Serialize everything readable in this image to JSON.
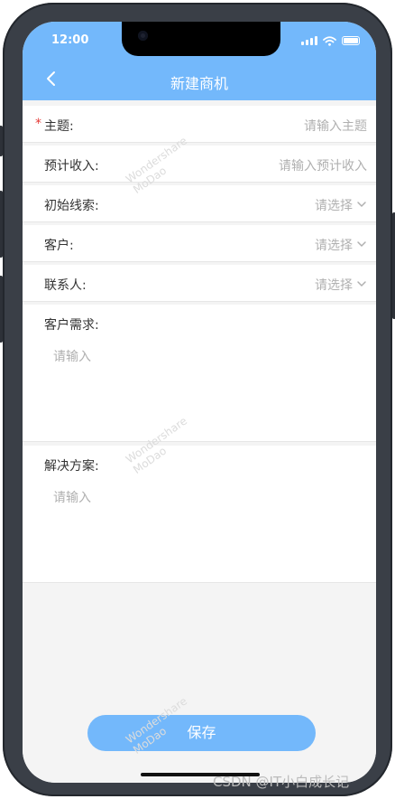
{
  "status_bar": {
    "time": "12:00"
  },
  "nav": {
    "title": "新建商机"
  },
  "form": {
    "topic": {
      "label": "主题:",
      "required_mark": "*",
      "placeholder": "请输入主题"
    },
    "expected_income": {
      "label": "预计收入:",
      "placeholder": "请输入预计收入"
    },
    "initial_lead": {
      "label": "初始线索:",
      "placeholder": "请选择"
    },
    "customer": {
      "label": "客户:",
      "placeholder": "请选择"
    },
    "contact": {
      "label": "联系人:",
      "placeholder": "请选择"
    },
    "customer_needs": {
      "label": "客户需求:",
      "placeholder": "请输入"
    },
    "solution": {
      "label": "解决方案:",
      "placeholder": "请输入"
    }
  },
  "actions": {
    "save_label": "保存"
  },
  "watermark": {
    "brand": "Wondershare",
    "product": "MoDao",
    "csdn": "CSDN @IT小白成长记"
  },
  "colors": {
    "accent": "#73b8fb",
    "required": "#e53935",
    "placeholder": "#b0b0b0"
  },
  "icons": {
    "back": "chevron-left-icon",
    "select": "chevron-down-icon"
  }
}
